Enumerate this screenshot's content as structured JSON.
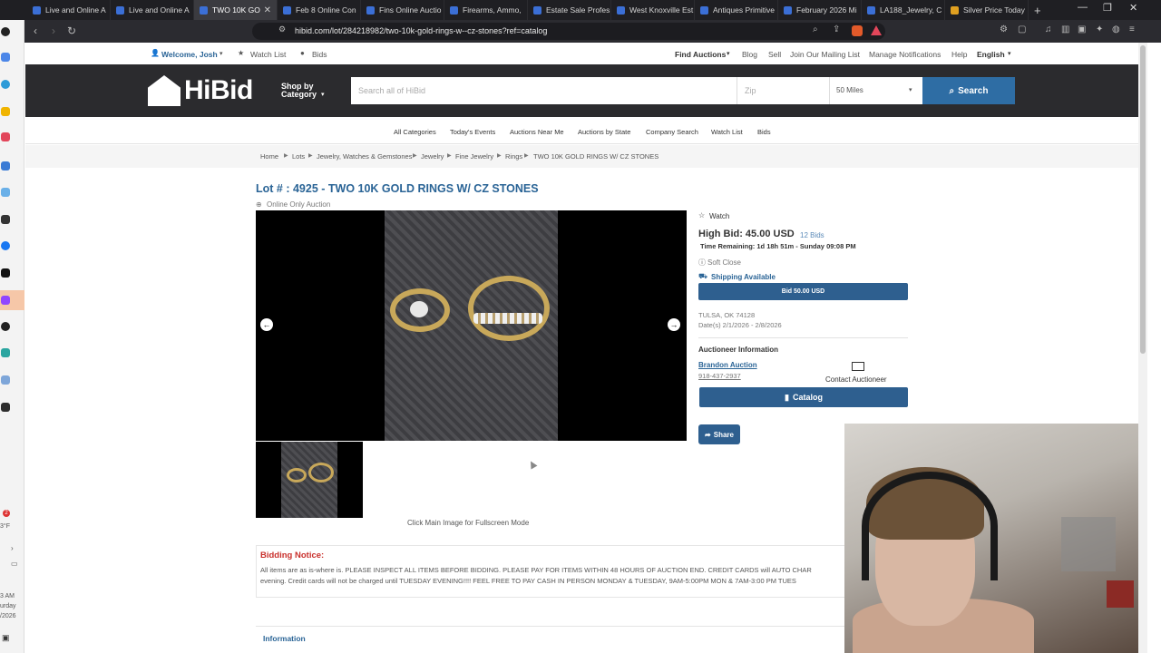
{
  "browser": {
    "tabs": [
      {
        "label": "Live and Online A",
        "color": "#3b6fd6"
      },
      {
        "label": "Live and Online A",
        "color": "#3b6fd6"
      },
      {
        "label": "TWO 10K GO",
        "color": "#3b6fd6"
      },
      {
        "label": "Feb 8 Online Con",
        "color": "#3b6fd6"
      },
      {
        "label": "Fins Online Auctio",
        "color": "#3b6fd6"
      },
      {
        "label": "Firearms, Ammo,",
        "color": "#3b6fd6"
      },
      {
        "label": "Estate Sale Profes",
        "color": "#3b6fd6"
      },
      {
        "label": "West Knoxville Est",
        "color": "#3b6fd6"
      },
      {
        "label": "Antiques Primitive",
        "color": "#3b6fd6"
      },
      {
        "label": "February 2026 Mi",
        "color": "#3b6fd6"
      },
      {
        "label": "LA188_Jewelry, C",
        "color": "#3b6fd6"
      },
      {
        "label": "Silver Price Today",
        "color": "#e0a020"
      }
    ],
    "url": "hibid.com/lot/284218982/two-10k-gold-rings-w--cz-stones?ref=catalog"
  },
  "os_tray": {
    "temp": "3°F",
    "time": "3 AM",
    "day": "urday",
    "date": "/2026",
    "badge": "2"
  },
  "util": {
    "welcome": "Welcome, Josh",
    "watch_list": "Watch List",
    "bids": "Bids",
    "find_auctions": "Find Auctions",
    "blog": "Blog",
    "sell": "Sell",
    "mailing": "Join Our Mailing List",
    "notifications": "Manage Notifications",
    "help": "Help",
    "language": "English"
  },
  "header": {
    "logo": "HiBid",
    "shop_by_1": "Shop by",
    "shop_by_2": "Category",
    "search_placeholder": "Search all of HiBid",
    "zip_placeholder": "Zip",
    "miles": "50 Miles",
    "search_button": "Search"
  },
  "nav": [
    "All Categories",
    "Today's Events",
    "Auctions Near Me",
    "Auctions by State",
    "Company Search",
    "Watch List",
    "Bids"
  ],
  "breadcrumb": [
    "Home",
    "Lots",
    "Jewelry, Watches & Gemstones",
    "Jewelry",
    "Fine Jewelry",
    "Rings",
    "TWO 10K GOLD RINGS W/ CZ STONES"
  ],
  "lot": {
    "title": "Lot # : 4925 - TWO 10K GOLD RINGS W/ CZ STONES",
    "auction_type": "Online Only Auction",
    "fullscreen_hint": "Click Main Image for Fullscreen Mode"
  },
  "bid": {
    "watch": "Watch",
    "high_bid": "High Bid: 45.00 USD",
    "bid_count": "12 Bids",
    "time_remaining": "Time Remaining: 1d 18h 51m - Sunday 09:08 PM",
    "soft_close": "Soft Close",
    "shipping": "Shipping Available",
    "bid_button": "Bid 50.00 USD",
    "location": "TULSA, OK 74128",
    "dates": "Date(s) 2/1/2026 - 2/8/2026",
    "auctioneer_heading": "Auctioneer Information",
    "auctioneer_name": "Brandon Auction",
    "auctioneer_phone": "918-437-2937",
    "contact": "Contact Auctioneer",
    "catalog": "Catalog",
    "share": "Share"
  },
  "notice": {
    "title": "Bidding Notice:",
    "line1": "All items are as is-where is. PLEASE INSPECT ALL ITEMS BEFORE BIDDING. PLEASE PAY FOR ITEMS WITHIN 48 HOURS OF AUCTION END. CREDIT CARDS will AUTO CHAR",
    "line2": "evening. Credit cards will not be charged until TUESDAY EVENING!!!! FEEL FREE TO PAY CASH IN PERSON MONDAY & TUESDAY, 9AM-5:00PM MON & 7AM-3:00 PM TUES"
  },
  "info_tab": "Information"
}
